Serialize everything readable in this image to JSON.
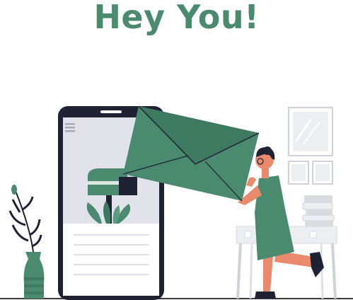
{
  "headline": {
    "text": "Hey You!"
  },
  "colors": {
    "brand_green": "#4a8a6e",
    "dark_green": "#3d7a5f",
    "phone_frame": "#1f2233",
    "screen_bg": "#e1e2ea",
    "ground": "#3a3a3a",
    "skin": "#e88a6b",
    "table": "#eceef2",
    "light_gray": "#d9dbe0"
  },
  "icons": {
    "envelope": "envelope-icon",
    "mailbox": "mailbox-icon",
    "menu": "hamburger-menu-icon",
    "vase": "vase-icon",
    "plant": "plant-icon",
    "person": "person-figure"
  }
}
